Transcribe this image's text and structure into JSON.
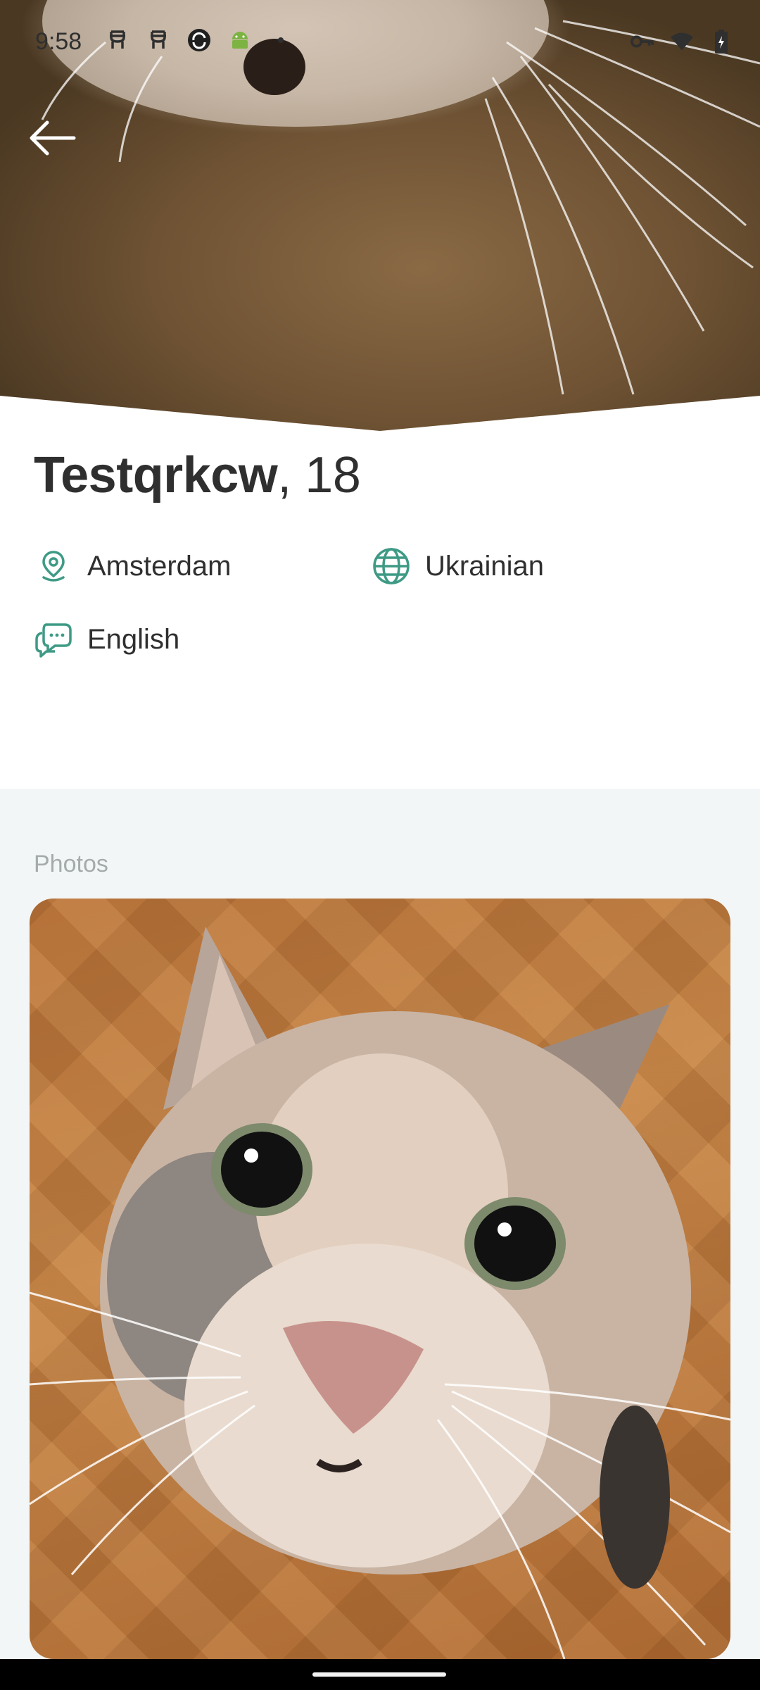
{
  "status_bar": {
    "time": "9:58",
    "left_icons": [
      "notification-icon",
      "notification-icon",
      "sync-icon",
      "android-icon",
      "dot-icon"
    ],
    "right_icons": [
      "key-icon",
      "wifi-icon",
      "battery-icon"
    ]
  },
  "header": {
    "back_icon": "arrow-left-icon"
  },
  "profile": {
    "name": "Testqrkcw",
    "age_text": ", 18",
    "city": "Amsterdam",
    "native_language": "Ukrainian",
    "spoken_language": "English"
  },
  "photos": {
    "section_title": "Photos"
  },
  "colors": {
    "accent": "#3e9a85",
    "text": "#2f2f2f",
    "muted": "#a5abab",
    "section_bg": "#f3f6f6"
  }
}
